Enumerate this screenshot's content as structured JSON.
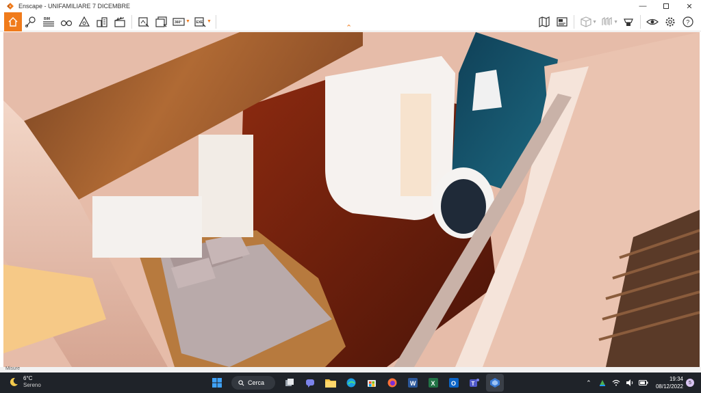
{
  "window": {
    "title": "Enscape - UNIFAMILIARE 7 DICEMBRE",
    "controls": [
      "minimize-icon",
      "maximize-icon",
      "close-icon"
    ]
  },
  "toolbar": {
    "left_tools": [
      "home-icon",
      "location-pin-icon",
      "bim-info-icon",
      "binoculars-icon",
      "asset-library-icon",
      "buildings-icon",
      "video-clapper-icon"
    ],
    "bim_label": "BIM",
    "export_tools": [
      {
        "icon": "export-image-icon",
        "has_dropdown": false
      },
      {
        "icon": "export-batch-icon",
        "has_dropdown": false
      },
      {
        "icon": "export-360-icon",
        "label": "360°",
        "has_dropdown": true
      },
      {
        "icon": "export-exe-icon",
        "label": "EXE",
        "has_dropdown": true
      }
    ],
    "right_tools": [
      "map-icon",
      "export-panel-icon",
      "cube-view-icon",
      "vr-headset-icon",
      "visibility-icon",
      "settings-icon",
      "help-icon"
    ],
    "accent_color": "#f07b1b"
  },
  "viewport": {
    "description_icon": "render-view",
    "status_text": "Misure"
  },
  "taskbar": {
    "weather": {
      "temp": "6°C",
      "condition": "Sereno"
    },
    "search_label": "Cerca",
    "apps": [
      "windows-start-icon",
      "search",
      "task-view-icon",
      "teams-chat-icon",
      "file-explorer-icon",
      "edge-icon",
      "store-icon",
      "firefox-icon",
      "word-icon",
      "excel-icon",
      "outlook-icon",
      "teams-icon",
      "enscape-icon"
    ],
    "clock": {
      "time": "19:34",
      "date": "08/12/2022"
    },
    "notifications": "5"
  }
}
